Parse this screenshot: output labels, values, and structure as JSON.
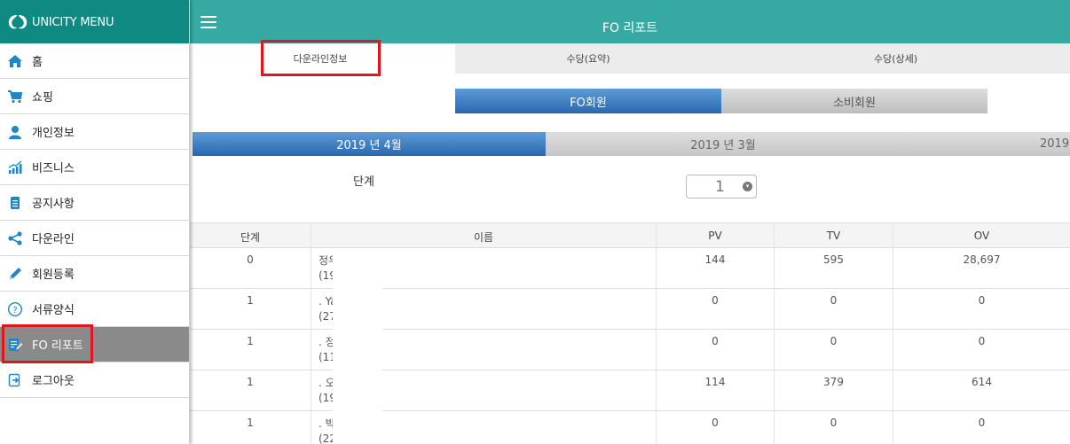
{
  "sidebar": {
    "title": "UNICITY MENU",
    "items": [
      {
        "label": "홈",
        "icon": "home-icon"
      },
      {
        "label": "쇼핑",
        "icon": "cart-icon"
      },
      {
        "label": "개인정보",
        "icon": "person-icon"
      },
      {
        "label": "비즈니스",
        "icon": "chart-icon"
      },
      {
        "label": "공지사항",
        "icon": "notice-icon"
      },
      {
        "label": "다운라인",
        "icon": "share-icon"
      },
      {
        "label": "회원등록",
        "icon": "pencil-icon"
      },
      {
        "label": "서류양식",
        "icon": "question-icon"
      },
      {
        "label": "FO 리포트",
        "icon": "report-icon"
      },
      {
        "label": "로그아웃",
        "icon": "logout-icon"
      }
    ]
  },
  "header": {
    "title": "FO 리포트"
  },
  "tabs": [
    "다운라인정보",
    "수당(요약)",
    "수당(상세)"
  ],
  "member_types": [
    "FO회원",
    "소비회원"
  ],
  "months": [
    "2019 년 4월",
    "2019 년 3월",
    "2019"
  ],
  "level": {
    "label": "단계",
    "value": "1"
  },
  "table": {
    "headers": [
      "단계",
      "이름",
      "PV",
      "TV",
      "OV"
    ],
    "rows": [
      {
        "level": "0",
        "name1": "정우",
        "name2": "(19",
        "pv": "144",
        "tv": "595",
        "ov": "28,697"
      },
      {
        "level": "1",
        "name1": ". Ya",
        "name2": "(27",
        "pv": "0",
        "tv": "0",
        "ov": "0"
      },
      {
        "level": "1",
        "name1": ". 정",
        "name2": "(11",
        "pv": "0",
        "tv": "0",
        "ov": "0"
      },
      {
        "level": "1",
        "name1": ". 오",
        "name2": "(19",
        "pv": "114",
        "tv": "379",
        "ov": "614"
      },
      {
        "level": "1",
        "name1": ". 박",
        "name2": "(22",
        "pv": "0",
        "tv": "0",
        "ov": "0"
      }
    ]
  },
  "colors": {
    "sidebar_header": "#0e8a82",
    "topbar": "#36a9a3",
    "active_blue": "#2a67b0",
    "highlight_red": "#e0161d",
    "icon_blue": "#1f86c8"
  }
}
